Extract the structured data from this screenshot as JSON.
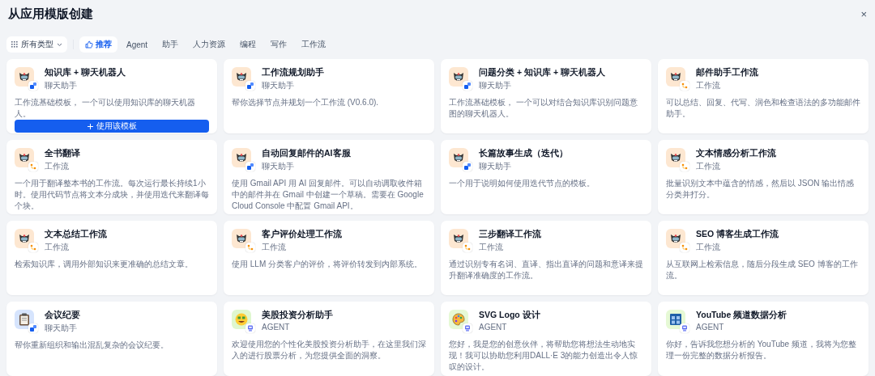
{
  "header": {
    "title": "从应用模版创建",
    "close": "×"
  },
  "filter": {
    "label": "所有类型"
  },
  "tabs": [
    {
      "label": "推荐",
      "selected": true
    },
    {
      "label": "Agent",
      "selected": false
    },
    {
      "label": "助手",
      "selected": false
    },
    {
      "label": "人力资源",
      "selected": false
    },
    {
      "label": "编程",
      "selected": false
    },
    {
      "label": "写作",
      "selected": false
    },
    {
      "label": "工作流",
      "selected": false
    }
  ],
  "cards": [
    {
      "title": "知识库 + 聊天机器人",
      "category": "聊天助手",
      "badge": {
        "kind": "chat"
      },
      "avatar": {
        "kind": "robot",
        "color": "#fde7d1"
      },
      "description": "工作流基础模板， 一个可以使用知识库的聊天机器人。",
      "action": "使用该模板"
    },
    {
      "title": "工作流规划助手",
      "category": "聊天助手",
      "badge": {
        "kind": "chat"
      },
      "avatar": {
        "kind": "robot",
        "color": "#fde7d1"
      },
      "description": "帮你选择节点并规划一个工作流 (V0.6.0)."
    },
    {
      "title": "问题分类 + 知识库 + 聊天机器人",
      "category": "聊天助手",
      "badge": {
        "kind": "chat"
      },
      "avatar": {
        "kind": "robot",
        "color": "#fde7d1"
      },
      "description": "工作流基础模板， 一个可以对结合知识库识别问题意图的聊天机器人。"
    },
    {
      "title": "邮件助手工作流",
      "category": "工作流",
      "badge": {
        "kind": "workflow"
      },
      "avatar": {
        "kind": "robot",
        "color": "#fde7d1"
      },
      "description": "可以总结、回复、代写、润色和检查语法的多功能邮件助手。"
    },
    {
      "title": "全书翻译",
      "category": "工作流",
      "badge": {
        "kind": "workflow"
      },
      "avatar": {
        "kind": "robot",
        "color": "#fde7d1"
      },
      "description": "一个用于翻译整本书的工作流。每次运行最长持续1小时。使用代码节点将文本分成块，并使用迭代来翻译每个块。"
    },
    {
      "title": "自动回复邮件的AI客服",
      "category": "聊天助手",
      "badge": {
        "kind": "chat"
      },
      "avatar": {
        "kind": "robot",
        "color": "#fde7d1"
      },
      "description": "使用 Gmail API 用 AI 回复邮件。可以自动调取收件箱中的邮件并在 Gmail 中创建一个草稿。需要在 Google Cloud Console 中配置 Gmail API。"
    },
    {
      "title": "长篇故事生成（迭代）",
      "category": "聊天助手",
      "badge": {
        "kind": "chat"
      },
      "avatar": {
        "kind": "robot",
        "color": "#fde7d1"
      },
      "description": "一个用于说明如何使用迭代节点的模板。"
    },
    {
      "title": "文本情感分析工作流",
      "category": "工作流",
      "badge": {
        "kind": "workflow"
      },
      "avatar": {
        "kind": "robot",
        "color": "#fde7d1"
      },
      "description": "批量识别文本中蕴含的情感，然后以 JSON 输出情感分类并打分。"
    },
    {
      "title": "文本总结工作流",
      "category": "工作流",
      "badge": {
        "kind": "workflow"
      },
      "avatar": {
        "kind": "robot",
        "color": "#fde7d1"
      },
      "description": "检索知识库，调用外部知识来更准确的总结文章。"
    },
    {
      "title": "客户评价处理工作流",
      "category": "工作流",
      "badge": {
        "kind": "workflow"
      },
      "avatar": {
        "kind": "robot",
        "color": "#fde7d1"
      },
      "description": "使用 LLM 分类客户的评价，将评价转发到内部系统。"
    },
    {
      "title": "三步翻译工作流",
      "category": "工作流",
      "badge": {
        "kind": "workflow"
      },
      "avatar": {
        "kind": "robot",
        "color": "#fde7d1"
      },
      "description": "通过识别专有名词、直译、指出直译的问题和意译来提升翻译准确度的工作流。"
    },
    {
      "title": "SEO 博客生成工作流",
      "category": "工作流",
      "badge": {
        "kind": "workflow"
      },
      "avatar": {
        "kind": "robot",
        "color": "#fde7d1"
      },
      "description": "从互联网上检索信息，随后分段生成 SEO 博客的工作流。"
    },
    {
      "title": "会议纪要",
      "category": "聊天助手",
      "badge": {
        "kind": "chat"
      },
      "avatar": {
        "kind": "clipboard",
        "color": "#d6e4fd"
      },
      "description": "帮你重新组织和输出混乱复杂的会议纪要。"
    },
    {
      "title": "美股投资分析助手",
      "category": "AGENT",
      "badge": {
        "kind": "agent"
      },
      "avatar": {
        "kind": "face",
        "color": "#dff7cf"
      },
      "description": "欢迎使用您的个性化美股投资分析助手，在这里我们深入的进行股票分析，为您提供全面的洞察。"
    },
    {
      "title": "SVG Logo 设计",
      "category": "AGENT",
      "badge": {
        "kind": "agent"
      },
      "avatar": {
        "kind": "palette",
        "color": "#e6f9d5"
      },
      "description": "您好，我是您的创意伙伴，将帮助您将想法生动地实现！我可以协助您利用DALL·E 3的能力创造出令人惊叹的设计。"
    },
    {
      "title": "YouTube 频道数据分析",
      "category": "AGENT",
      "badge": {
        "kind": "agent"
      },
      "avatar": {
        "kind": "chart",
        "color": "#e6f9d5"
      },
      "description": "你好，告诉我您想分析的 YouTube 频道，我将为您整理一份完整的数据分析报告。"
    }
  ]
}
